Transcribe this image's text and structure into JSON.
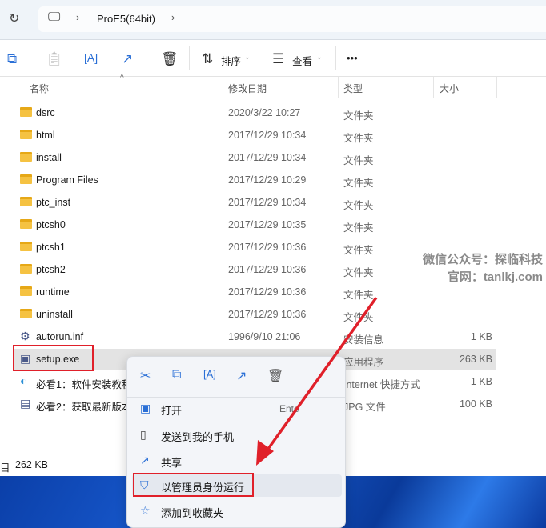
{
  "address": {
    "path": [
      "ProE5(64bit)"
    ]
  },
  "toolbar": {
    "sort_label": "排序",
    "view_label": "查看",
    "more_label": "•••"
  },
  "columns": [
    "名称",
    "修改日期",
    "类型",
    "大小"
  ],
  "files": [
    {
      "name": "dsrc",
      "date": "2020/3/22 10:27",
      "type": "文件夹",
      "size": "",
      "icon": "folder"
    },
    {
      "name": "html",
      "date": "2017/12/29 10:34",
      "type": "文件夹",
      "size": "",
      "icon": "folder"
    },
    {
      "name": "install",
      "date": "2017/12/29 10:34",
      "type": "文件夹",
      "size": "",
      "icon": "folder"
    },
    {
      "name": "Program Files",
      "date": "2017/12/29 10:29",
      "type": "文件夹",
      "size": "",
      "icon": "folder"
    },
    {
      "name": "ptc_inst",
      "date": "2017/12/29 10:34",
      "type": "文件夹",
      "size": "",
      "icon": "folder"
    },
    {
      "name": "ptcsh0",
      "date": "2017/12/29 10:35",
      "type": "文件夹",
      "size": "",
      "icon": "folder"
    },
    {
      "name": "ptcsh1",
      "date": "2017/12/29 10:36",
      "type": "文件夹",
      "size": "",
      "icon": "folder"
    },
    {
      "name": "ptcsh2",
      "date": "2017/12/29 10:36",
      "type": "文件夹",
      "size": "",
      "icon": "folder"
    },
    {
      "name": "runtime",
      "date": "2017/12/29 10:36",
      "type": "文件夹",
      "size": "",
      "icon": "folder"
    },
    {
      "name": "uninstall",
      "date": "2017/12/29 10:36",
      "type": "文件夹",
      "size": "",
      "icon": "folder"
    },
    {
      "name": "autorun.inf",
      "date": "1996/9/10 21:06",
      "type": "安装信息",
      "size": "1 KB",
      "icon": "settings-file"
    },
    {
      "name": "setup.exe",
      "date": "",
      "type": "应用程序",
      "size": "263 KB",
      "icon": "exe"
    },
    {
      "name": "必看1：软件安装教程",
      "date": "",
      "type": "Internet 快捷方式",
      "size": "1 KB",
      "icon": "edge"
    },
    {
      "name": "必看2：获取最新版本",
      "date": "",
      "type": "JPG 文件",
      "size": "100 KB",
      "icon": "image"
    }
  ],
  "status": {
    "selected": "目",
    "size": "262 KB"
  },
  "context_menu": {
    "items": [
      {
        "label": "打开",
        "shortcut": "Ente",
        "icon": "open-icon"
      },
      {
        "label": "发送到我的手机",
        "icon": "phone-icon"
      },
      {
        "label": "共享",
        "icon": "share-icon"
      },
      {
        "label": "以管理员身份运行",
        "icon": "shield-icon"
      },
      {
        "label": "添加到收藏夹",
        "icon": "star-icon"
      }
    ]
  },
  "watermark": {
    "line1": "微信公众号：探临科技",
    "line2": "官网：tanlkj.com"
  }
}
